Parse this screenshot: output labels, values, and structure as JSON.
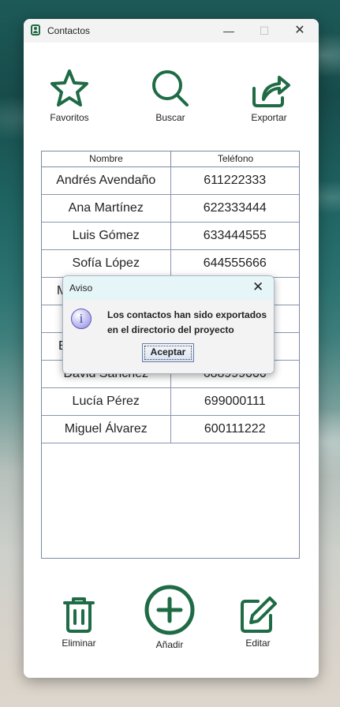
{
  "window": {
    "title": "Contactos"
  },
  "toolbar": {
    "favoritos": "Favoritos",
    "buscar": "Buscar",
    "exportar": "Exportar"
  },
  "table": {
    "headers": [
      "Nombre",
      "Teléfono"
    ],
    "rows": [
      [
        "Andrés Avendaño",
        "611222333"
      ],
      [
        "Ana Martínez",
        "622333444"
      ],
      [
        "Luis Gómez",
        "633444555"
      ],
      [
        "Sofía López",
        "644555666"
      ],
      [
        "M",
        ""
      ],
      [
        "",
        ""
      ],
      [
        "E",
        ""
      ],
      [
        "David Sánchez",
        "688999000"
      ],
      [
        "Lucía Pérez",
        "699000111"
      ],
      [
        "Miguel Álvarez",
        "600111222"
      ]
    ]
  },
  "bottom": {
    "eliminar": "Eliminar",
    "anadir": "Añadir",
    "editar": "Editar"
  },
  "dialog": {
    "title": "Aviso",
    "message_line1": "Los contactos han sido exportados",
    "message_line2": "en el directorio del proyecto",
    "ok": "Aceptar"
  },
  "colors": {
    "accent": "#1f6b46"
  }
}
